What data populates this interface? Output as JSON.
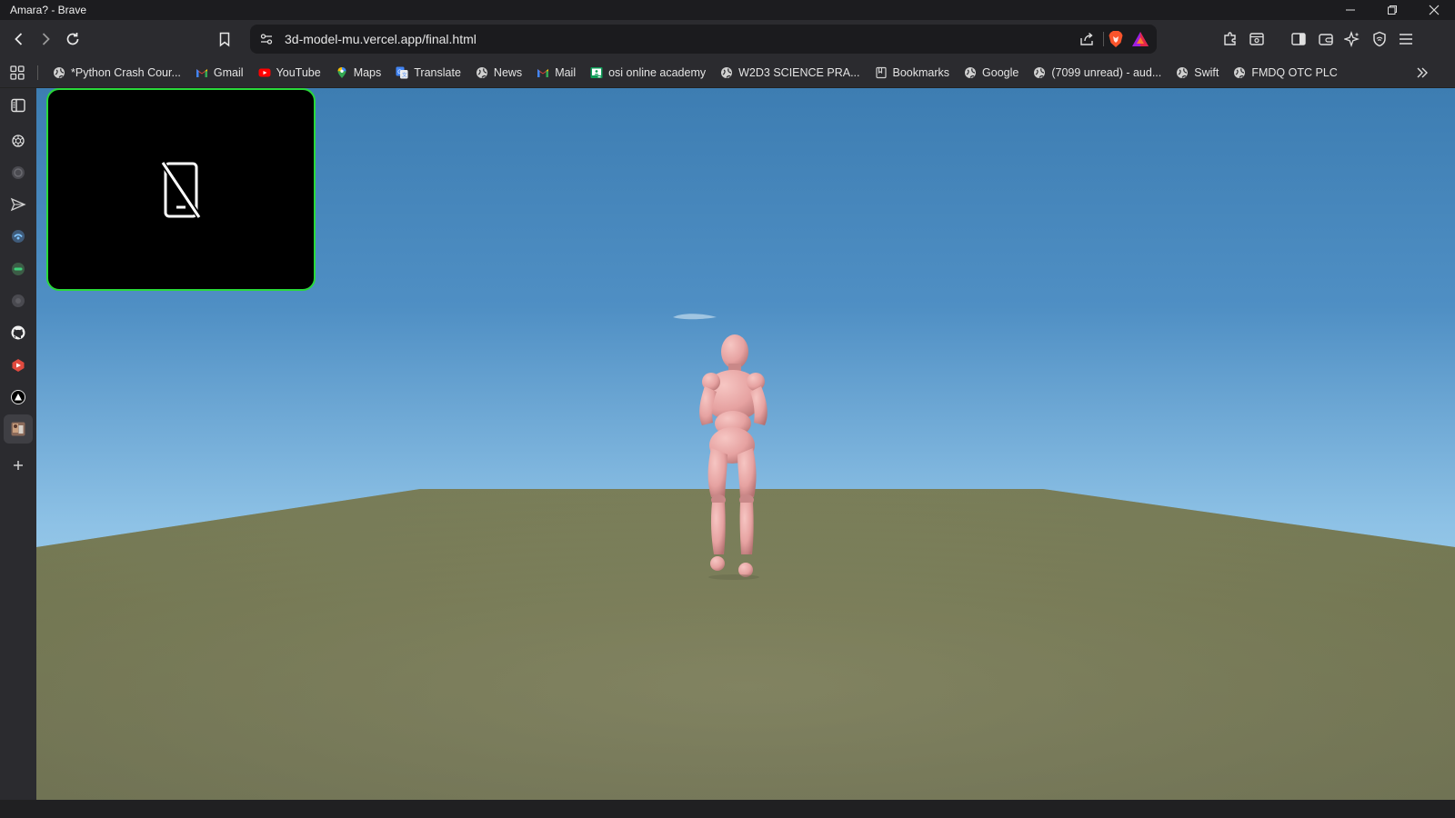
{
  "window": {
    "title": "Amara? - Brave"
  },
  "navigation": {
    "url": "3d-model-mu.vercel.app/final.html"
  },
  "bookmarks": [
    {
      "label": "*Python Crash Cour...",
      "icon": "globe-icon"
    },
    {
      "label": "Gmail",
      "icon": "gmail-icon"
    },
    {
      "label": "YouTube",
      "icon": "youtube-icon"
    },
    {
      "label": "Maps",
      "icon": "maps-icon"
    },
    {
      "label": "Translate",
      "icon": "translate-icon"
    },
    {
      "label": "News",
      "icon": "globe-icon"
    },
    {
      "label": "Mail",
      "icon": "gmail-icon"
    },
    {
      "label": "osi online academy",
      "icon": "classroom-icon"
    },
    {
      "label": "W2D3 SCIENCE PRA...",
      "icon": "globe-icon"
    },
    {
      "label": "Bookmarks",
      "icon": "folder-icon"
    },
    {
      "label": "Google",
      "icon": "globe-icon"
    },
    {
      "label": "(7099 unread) - aud...",
      "icon": "globe-icon"
    },
    {
      "label": "Swift",
      "icon": "globe-icon"
    },
    {
      "label": "FMDQ OTC PLC",
      "icon": "globe-icon"
    }
  ],
  "sidebar": [
    "sidebar-panel-icon",
    "chatgpt-icon",
    "circle-app-icon",
    "send-app-icon",
    "blue-app-icon",
    "green-app-icon",
    "circle-app-icon-2",
    "github-icon",
    "red-app-icon",
    "triangle-app-icon",
    "profile-app-icon",
    "add-icon"
  ],
  "scene": {
    "camera_preview_icon": "no-phone-icon",
    "colors": {
      "sky_top": "#3f7fb4",
      "sky_horizon": "#b6d9ef",
      "ground": "#7b7e5a",
      "figure": "#e9a5a5",
      "camera_border": "#29d93a"
    }
  }
}
